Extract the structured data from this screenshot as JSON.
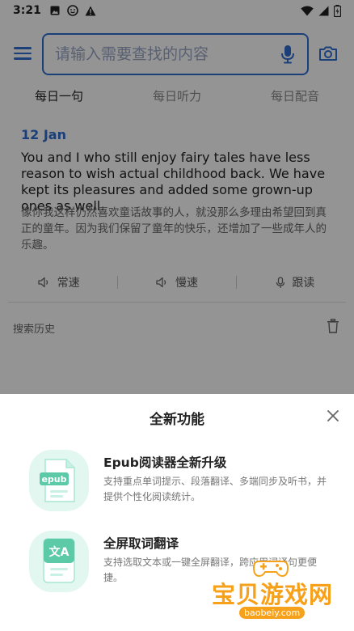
{
  "status_bar": {
    "time": "3:21"
  },
  "search": {
    "placeholder": "请输入需要查找的内容"
  },
  "tabs": [
    {
      "label": "每日一句"
    },
    {
      "label": "每日听力"
    },
    {
      "label": "每日配音"
    }
  ],
  "daily": {
    "date": "12 Jan",
    "en": "You and I who still enjoy fairy tales have less reason to wish actual childhood back. We have kept its pleasures and added some grown-up ones as well.",
    "cn": "像你我这样仍然喜欢童话故事的人，就没那么多理由希望回到真正的童年。因为我们保留了童年的快乐，还增加了一些成年人的乐趣。",
    "play_normal": "常速",
    "play_slow": "慢速",
    "follow": "跟读"
  },
  "history": {
    "label": "搜索历史"
  },
  "sheet": {
    "title": "全新功能",
    "features": [
      {
        "icon_label": "epub",
        "title": "Epub阅读器全新升级",
        "desc": "支持重点单词提示、段落翻译、多端同步及听书，并提供个性化阅读统计。"
      },
      {
        "icon_label": "文A",
        "title": "全屏取词翻译",
        "desc": "支持选取文本或一键全屏翻译，跨应用词译句更便捷。"
      }
    ]
  },
  "watermark": {
    "text": "宝贝游戏网",
    "url": "baobeiy.com"
  },
  "colors": {
    "accent": "#2f6fd1",
    "feature_icon_bg": "#e2f7f0",
    "feature_icon_fg": "#5cc9a7",
    "watermark": "#f7a11a"
  }
}
